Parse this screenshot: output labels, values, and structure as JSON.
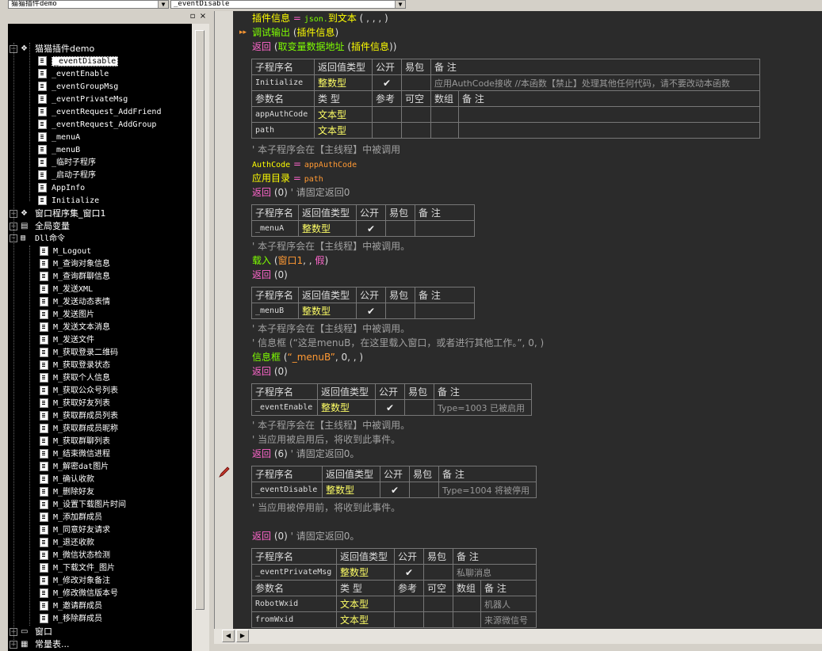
{
  "top_bar": {
    "combo_left": "猫猫插件demo",
    "combo_right": "_eventDisable"
  },
  "tree": {
    "root": "猫猫插件demo",
    "items": [
      "_eventDisable",
      "_eventEnable",
      "_eventGroupMsg",
      "_eventPrivateMsg",
      "_eventRequest_AddFriend",
      "_eventRequest_AddGroup",
      "_menuA",
      "_menuB",
      "_临时子程序",
      "_启动子程序",
      "AppInfo",
      "Initialize"
    ],
    "selected": "_eventDisable",
    "window_set": "窗口程序集_窗口1",
    "globals": "全局变量",
    "dll": "Dll命令",
    "dll_items": [
      "M_Logout",
      "M_查询对象信息",
      "M_查询群聊信息",
      "M_发送XML",
      "M_发送动态表情",
      "M_发送图片",
      "M_发送文本消息",
      "M_发送文件",
      "M_获取登录二维码",
      "M_获取登录状态",
      "M_获取个人信息",
      "M_获取公众号列表",
      "M_获取好友列表",
      "M_获取群成员列表",
      "M_获取群成员昵称",
      "M_获取群聊列表",
      "M_结束微信进程",
      "M_解密dat图片",
      "M_确认收款",
      "M_删除好友",
      "M_设置下载图片时间",
      "M_添加群成员",
      "M_同意好友请求",
      "M_退还收款",
      "M_微信状态检测",
      "M_下载文件_图片",
      "M_修改对象备注",
      "M_修改微信版本号",
      "M_邀请群成员",
      "M_移除群成员"
    ],
    "window": "窗口",
    "consts": "常量表..."
  },
  "code": {
    "line1": {
      "a": "插件信息",
      "b": " = ",
      "c": "json.",
      "d": "到文本",
      "e": " ( , , , )"
    },
    "line2": {
      "a": "调试输出",
      "b": " (",
      "c": "插件信息",
      "d": ")"
    },
    "line3": {
      "a": "返回",
      "b": " (",
      "c": "取变量数据地址",
      "d": " (",
      "e": "插件信息",
      "f": "))"
    },
    "tbl_head": {
      "name": "子程序名",
      "ret": "返回值类型",
      "pub": "公开",
      "easy": "易包",
      "note": "备 注"
    },
    "param_head": {
      "name": "参数名",
      "type": "类 型",
      "ref": "参考",
      "null": "可空",
      "arr": "数组",
      "note": "备 注"
    },
    "check": "✔",
    "t1": {
      "name": "Initialize",
      "ret": "整数型",
      "note": "应用AuthCode接收 //本函数【禁止】处理其他任何代码，请不要改动本函数",
      "p1": {
        "name": "appAuthCode",
        "type": "文本型"
      },
      "p2": {
        "name": "path",
        "type": "文本型"
      }
    },
    "c1": "' 本子程序会在【主线程】中被调用",
    "c2": {
      "a": "AuthCode",
      "b": " = ",
      "c": "appAuthCode"
    },
    "c3": {
      "a": "应用目录",
      "b": " = ",
      "c": "path"
    },
    "c4": {
      "a": "返回",
      "b": " (0)",
      "c": " ' 请固定返回0"
    },
    "t2": {
      "name": "_menuA",
      "ret": "整数型"
    },
    "c5": "' 本子程序会在【主线程】中被调用。",
    "c6": {
      "a": "载入",
      "b": " (",
      "c": "窗口1",
      "d": ", , ",
      "e": "假",
      "f": ")"
    },
    "c7": {
      "a": "返回",
      "b": " (0)"
    },
    "t3": {
      "name": "_menuB",
      "ret": "整数型"
    },
    "c8": "' 本子程序会在【主线程】中被调用。",
    "c9": "' 信息框 (“这是menuB，在这里载入窗口，或者进行其他工作。”, 0, )",
    "c10": {
      "a": "信息框",
      "b": " (",
      "c": "“_menuB”",
      "d": ", 0, , )"
    },
    "c11": {
      "a": "返回",
      "b": " (0)"
    },
    "t4": {
      "name": "_eventEnable",
      "ret": "整数型",
      "note": "Type=1003 已被启用"
    },
    "c12": "' 本子程序会在【主线程】中被调用。",
    "c13": "' 当应用被启用后，将收到此事件。",
    "c14": {
      "a": "返回",
      "b": " (6)",
      "c": " ' 请固定返回0。"
    },
    "t5": {
      "name": "_eventDisable",
      "ret": "整数型",
      "note": "Type=1004 将被停用"
    },
    "c15": "' 当应用被停用前，将收到此事件。",
    "c16": {
      "a": "返回",
      "b": " (0)",
      "c": " ' 请固定返回0。"
    },
    "t6": {
      "name": "_eventPrivateMsg",
      "ret": "整数型",
      "note": "私聊消息",
      "p1": {
        "name": "RobotWxid",
        "type": "文本型",
        "note": "机器人"
      },
      "p2": {
        "name": "fromWxid",
        "type": "文本型",
        "note": "来源微信号"
      }
    }
  }
}
